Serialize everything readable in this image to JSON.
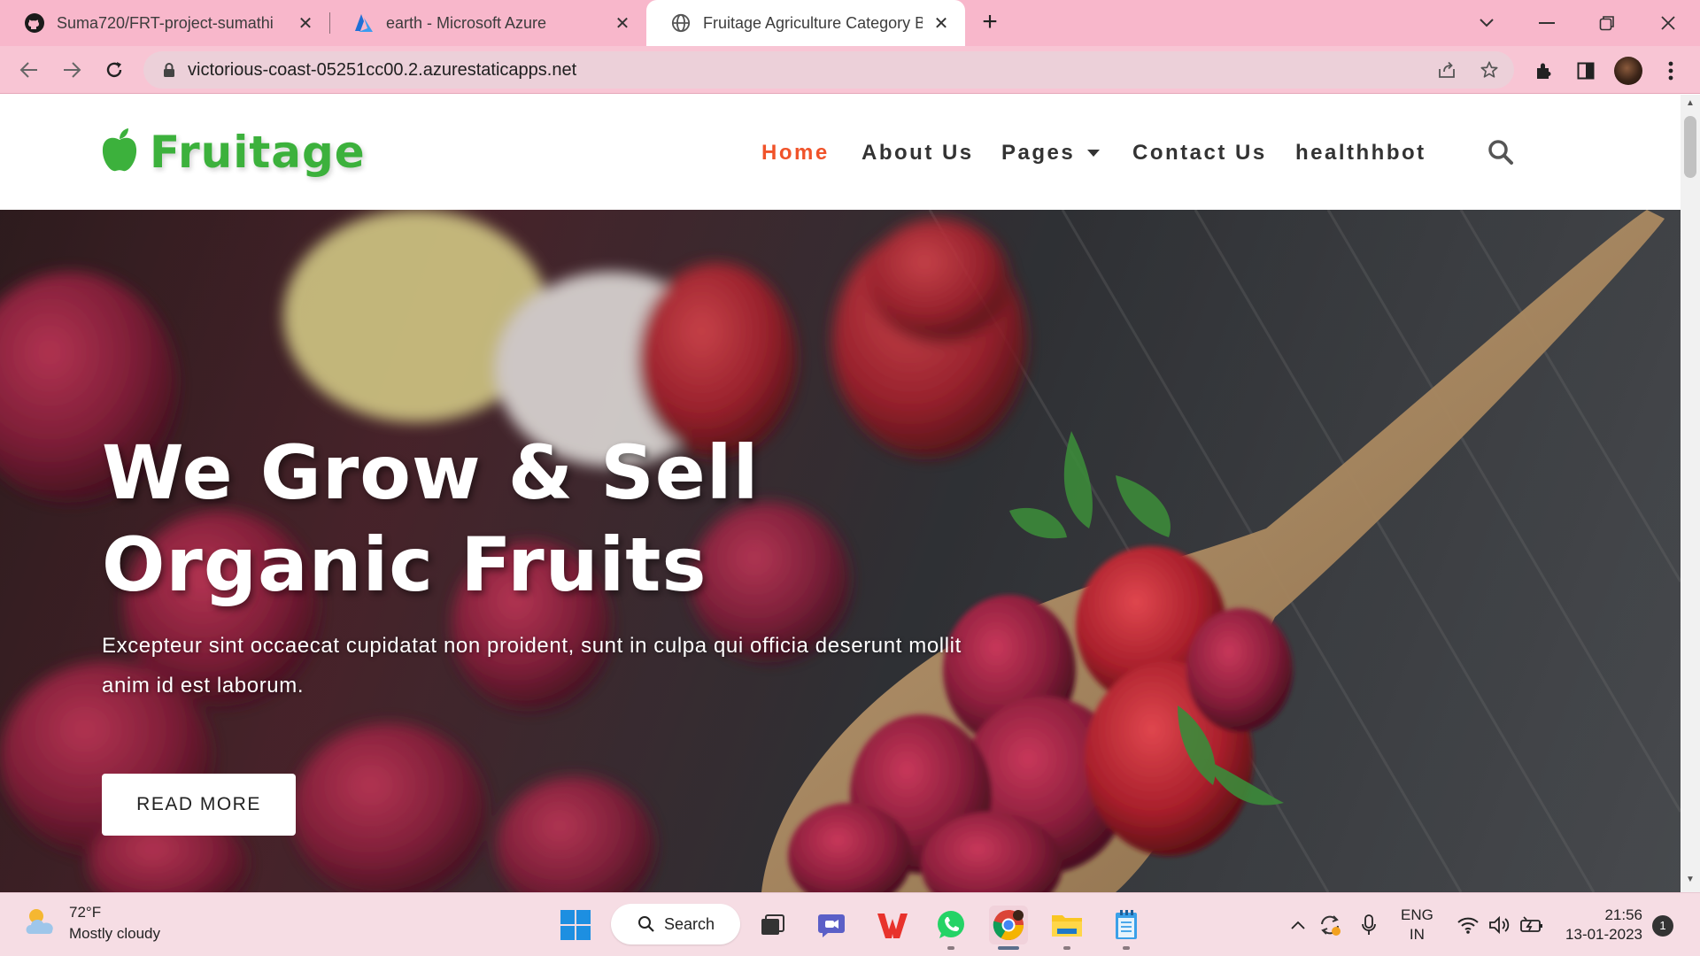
{
  "browser": {
    "tabs": [
      {
        "title": "Suma720/FRT-project-sumathi",
        "icon": "github-icon",
        "active": false
      },
      {
        "title": "earth - Microsoft Azure",
        "icon": "azure-icon",
        "active": false
      },
      {
        "title": "Fruitage Agriculture Category Bo",
        "icon": "globe-icon",
        "active": true
      }
    ],
    "url": "victorious-coast-05251cc00.2.azurestaticapps.net"
  },
  "site": {
    "logo_text": "Fruitage",
    "nav": {
      "home": "Home",
      "about": "About Us",
      "pages": "Pages",
      "contact": "Contact Us",
      "bot": "healthhbot"
    },
    "hero": {
      "title_line1": "We Grow & Sell",
      "title_line2": "Organic Fruits",
      "text": "Excepteur sint occaecat cupidatat non proident, sunt in culpa qui officia deserunt mollit anim id est laborum.",
      "button": "READ MORE"
    },
    "accent_color": "#f0532a",
    "brand_color": "#3cb13c"
  },
  "taskbar": {
    "weather_temp": "72°F",
    "weather_desc": "Mostly cloudy",
    "search_label": "Search",
    "lang_line1": "ENG",
    "lang_line2": "IN",
    "time": "21:56",
    "date": "13-01-2023",
    "notifications": "1"
  }
}
